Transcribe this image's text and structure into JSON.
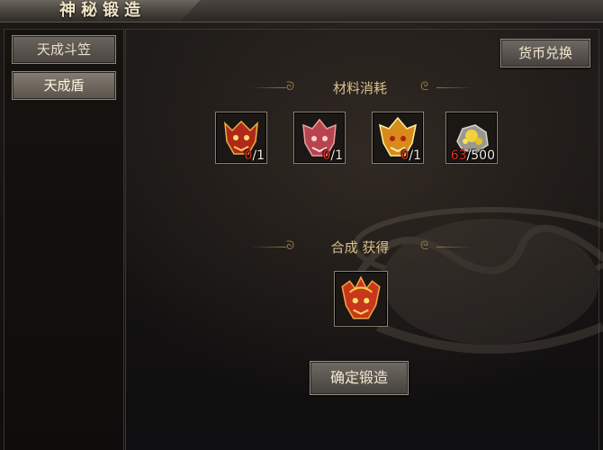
{
  "window": {
    "title": "神秘锻造"
  },
  "sidebar": {
    "items": [
      {
        "label": "天成斗笠"
      },
      {
        "label": "天成盾"
      }
    ]
  },
  "header": {
    "currency_exchange_label": "货币兑换"
  },
  "materials": {
    "title": "材料消耗",
    "items": [
      {
        "icon": "red-demon-helmet-icon",
        "have": "0",
        "need": "1"
      },
      {
        "icon": "pink-demon-helmet-icon",
        "have": "0",
        "need": "1"
      },
      {
        "icon": "gold-demon-helmet-icon",
        "have": "0",
        "need": "1"
      },
      {
        "icon": "gold-ore-icon",
        "have": "63",
        "need": "500"
      }
    ]
  },
  "result": {
    "title": "合成 获得",
    "item": {
      "icon": "flame-demon-helmet-icon"
    }
  },
  "actions": {
    "confirm_label": "确定锻造"
  },
  "colors": {
    "accent_gold": "#d9c08a",
    "insufficient_red": "#e0321f"
  }
}
